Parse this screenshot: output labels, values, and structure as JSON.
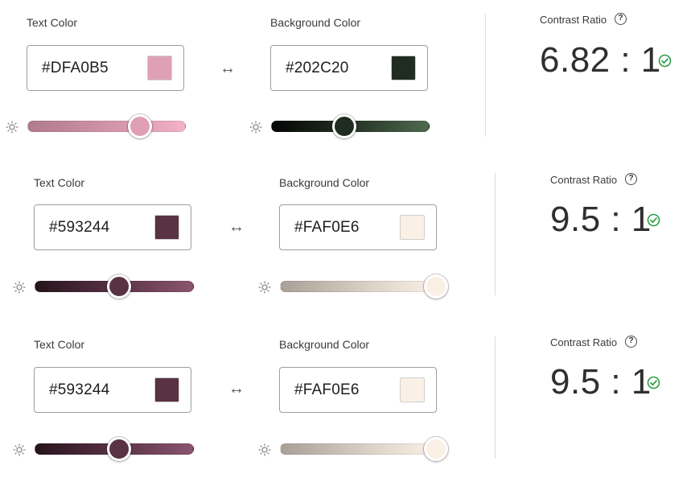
{
  "pairs": [
    {
      "text_label": "Text Color",
      "text_hex": "#DFA0B5",
      "text_track": "linear-gradient(to right, #b07a8d, #dd9db2 70%, #f3b3c7)",
      "bg_label": "Background Color",
      "bg_hex": "#202C20",
      "bg_track": "linear-gradient(to right, #050705, #202c20 45%, #4f6a4f)",
      "text_level": 0.71,
      "bg_level": 0.46,
      "contrast_label": "Contrast Ratio",
      "help_glyph": "?",
      "ratio": "6.82 : 1",
      "pass": true
    },
    {
      "text_label": "Text Color",
      "text_hex": "#593244",
      "text_track": "linear-gradient(to right, #26141c, #593244 50%, #8a5570)",
      "bg_label": "Background Color",
      "bg_hex": "#FAF0E6",
      "bg_track": "linear-gradient(to right, #a8a096, #dcd3c9 60%, #faf0e6)",
      "text_level": 0.53,
      "bg_level": 1.0,
      "contrast_label": "Contrast Ratio",
      "help_glyph": "?",
      "ratio": "9.5 : 1",
      "pass": true
    },
    {
      "text_label": "Text Color",
      "text_hex": "#593244",
      "text_track": "linear-gradient(to right, #26141c, #593244 50%, #8a5570)",
      "bg_label": "Background Color",
      "bg_hex": "#FAF0E6",
      "bg_track": "linear-gradient(to right, #a8a096, #dcd3c9 60%, #faf0e6)",
      "text_level": 0.53,
      "bg_level": 1.0,
      "contrast_label": "Contrast Ratio",
      "help_glyph": "?",
      "ratio": "9.5 : 1",
      "pass": true
    }
  ],
  "icons": {
    "brightness": "sun-icon",
    "swap": "swap-arrows-icon",
    "help": "help-circle-icon",
    "pass": "check-circle-icon"
  },
  "colors": {
    "pass": "#2d9d45",
    "divider": "#dcdcdc"
  }
}
